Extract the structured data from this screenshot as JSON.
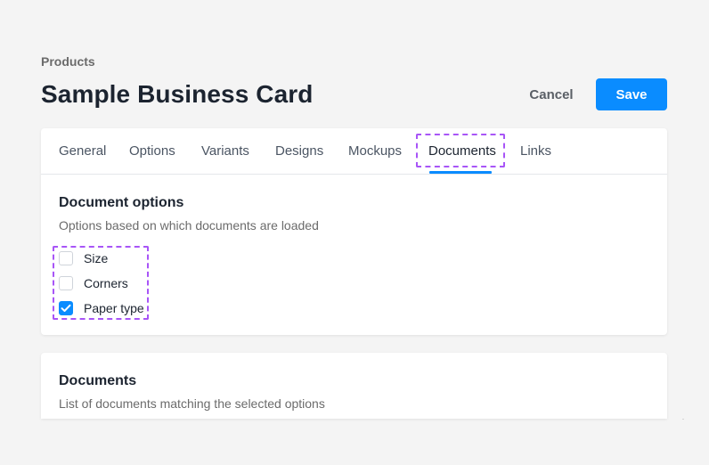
{
  "header": {
    "breadcrumb": "Products",
    "title": "Sample Business Card",
    "cancel_label": "Cancel",
    "save_label": "Save"
  },
  "tabs": [
    {
      "label": "General",
      "active": false
    },
    {
      "label": "Options",
      "active": false
    },
    {
      "label": "Variants",
      "active": false
    },
    {
      "label": "Designs",
      "active": false
    },
    {
      "label": "Mockups",
      "active": false
    },
    {
      "label": "Documents",
      "active": true
    },
    {
      "label": "Links",
      "active": false
    }
  ],
  "document_options": {
    "title": "Document options",
    "subtitle": "Options based on which documents are loaded",
    "items": [
      {
        "label": "Size",
        "checked": false
      },
      {
        "label": "Corners",
        "checked": false
      },
      {
        "label": "Paper type",
        "checked": true
      }
    ]
  },
  "documents": {
    "title": "Documents",
    "subtitle": "List of documents matching the selected options"
  },
  "colors": {
    "accent": "#0a8cff",
    "highlight": "#a855f7",
    "background": "#f4f4f4"
  }
}
